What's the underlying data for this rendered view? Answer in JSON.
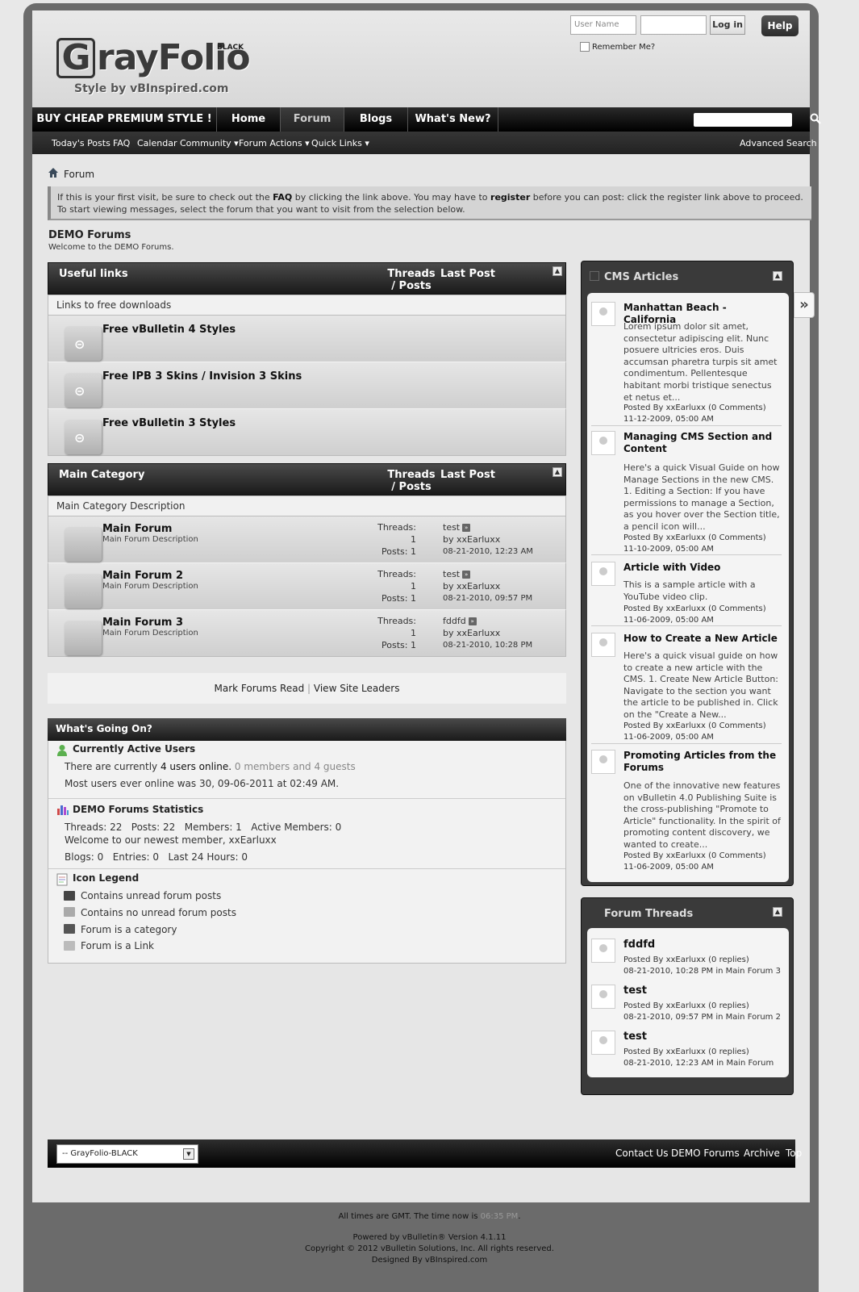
{
  "header": {
    "logo_text": "rayFolio",
    "logo_initial": "G",
    "logo_badge": "BLACK",
    "logo_sub": "Style by vBInspired.com",
    "login": {
      "user_placeholder": "User Name",
      "pass_placeholder": "",
      "login_btn": "Log in",
      "remember": "Remember Me?"
    },
    "help": "Help"
  },
  "navbar": {
    "tabs": [
      "BUY CHEAP PREMIUM STYLE !",
      "Home",
      "Forum",
      "Blogs",
      "What's New?"
    ],
    "selected_tab": "Forum",
    "sub_items": [
      "Today's Posts",
      "FAQ",
      "Calendar",
      "Community",
      "Forum Actions",
      "Quick Links"
    ],
    "advanced_search": "Advanced Search"
  },
  "breadcrumb": "Forum",
  "notice": {
    "pre": "If this is your first visit, be sure to check out the ",
    "faq": "FAQ",
    "mid": " by clicking the link above. You may have to ",
    "register": "register",
    "post": " before you can post: click the register link above to proceed. To start viewing messages, select the forum that you want to visit from the selection below."
  },
  "page": {
    "title": "DEMO Forums",
    "desc": "Welcome to the DEMO Forums."
  },
  "useful": {
    "title": "Useful links",
    "col_threads": "Threads / Posts",
    "col_last": "Last Post",
    "desc": "Links to free downloads",
    "forums": [
      "Free vBulletin 4 Styles",
      "Free IPB 3 Skins / Invision 3 Skins",
      "Free vBulletin 3 Styles"
    ]
  },
  "main_cat": {
    "title": "Main Category",
    "col_threads": "Threads / Posts",
    "col_last": "Last Post",
    "desc": "Main Category Description",
    "forums": [
      {
        "title": "Main Forum",
        "desc": "Main Forum Description",
        "threads_lbl": "Threads:",
        "threads": "1",
        "posts_lbl": "Posts:",
        "posts": "1",
        "last_title": "test",
        "by": "by",
        "last_user": "xxEarluxx",
        "last_date": "08-21-2010, 12:23 AM"
      },
      {
        "title": "Main Forum 2",
        "desc": "Main Forum Description",
        "threads_lbl": "Threads:",
        "threads": "1",
        "posts_lbl": "Posts:",
        "posts": "1",
        "last_title": "test",
        "by": "by",
        "last_user": "xxEarluxx",
        "last_date": "08-21-2010, 09:57 PM"
      },
      {
        "title": "Main Forum 3",
        "desc": "Main Forum Description",
        "threads_lbl": "Threads:",
        "threads": "1",
        "posts_lbl": "Posts:",
        "posts": "1",
        "last_title": "fddfd",
        "by": "by",
        "last_user": "xxEarluxx",
        "last_date": "08-21-2010, 10:28 PM"
      }
    ]
  },
  "markbar": {
    "mark": "Mark Forums Read",
    "sep": "|",
    "leaders": "View Site Leaders"
  },
  "wgo": {
    "title": "What's Going On?",
    "active_title": "Currently Active Users",
    "active_pre": "There are currently ",
    "active_link": "4 users online.",
    "active_post": " 0 members and 4 guests",
    "most": "Most users ever online was 30, 09-06-2011 at 02:49 AM.",
    "stats_title": "DEMO Forums Statistics",
    "stats_line1": "Threads: 22   Posts: 22   Members: 1   Active Members: 0",
    "stats_newest_pre": "Welcome to our newest member, ",
    "stats_newest": "xxEarluxx",
    "stats_blogs": "Blogs: 0   Entries: 0   Last 24 Hours: 0",
    "legend_title": "Icon Legend",
    "legend": [
      "Contains unread forum posts",
      "Contains no unread forum posts",
      "Forum is a category",
      "Forum is a Link"
    ]
  },
  "cms": {
    "title": "CMS Articles",
    "articles": [
      {
        "title": "Manhattan Beach - California",
        "body": "Lorem ipsum dolor sit amet, consectetur adipiscing elit. Nunc posuere ultricies eros. Duis accumsan pharetra turpis sit amet condimentum. Pellentesque habitant morbi tristique senectus et netus et...",
        "posted_by": "Posted By",
        "user": "xxEarluxx",
        "comments": "(0 Comments)",
        "date": "11-12-2009, 05:00 AM"
      },
      {
        "title": "Managing CMS Section and Content",
        "body": "Here's a quick Visual Guide on how Manage Sections in the new CMS. 1. Editing a Section: If you have permissions to manage a Section, as you hover over the Section title, a pencil icon will...",
        "posted_by": "Posted By",
        "user": "xxEarluxx",
        "comments": "(0 Comments)",
        "date": "11-10-2009, 05:00 AM"
      },
      {
        "title": "Article with Video",
        "body": "This is a sample article with a YouTube video clip.",
        "posted_by": "Posted By",
        "user": "xxEarluxx",
        "comments": "(0 Comments)",
        "date": "11-06-2009, 05:00 AM"
      },
      {
        "title": "How to Create a New Article",
        "body": "Here's a quick visual guide on how to create a new article with the CMS. 1. Create New Article Button: Navigate to the section you want the article to be published in. Click on the \"Create a New...",
        "posted_by": "Posted By",
        "user": "xxEarluxx",
        "comments": "(0 Comments)",
        "date": "11-06-2009, 05:00 AM"
      },
      {
        "title": "Promoting Articles from the Forums",
        "body": "One of the innovative new features on vBulletin 4.0 Publishing Suite is the cross-publishing \"Promote to Article\" functionality. In the spirit of promoting content discovery, we wanted to create...",
        "posted_by": "Posted By",
        "user": "xxEarluxx",
        "comments": "(0 Comments)",
        "date": "11-06-2009, 05:00 AM"
      }
    ]
  },
  "threads": {
    "title": "Forum Threads",
    "items": [
      {
        "title": "fddfd",
        "posted_by": "Posted By",
        "user": "xxEarluxx",
        "replies": "(0 replies)",
        "date": "08-21-2010, 10:28 PM",
        "in": "in",
        "forum": "Main Forum 3"
      },
      {
        "title": "test",
        "posted_by": "Posted By",
        "user": "xxEarluxx",
        "replies": "(0 replies)",
        "date": "08-21-2010, 09:57 PM",
        "in": "in",
        "forum": "Main Forum 2"
      },
      {
        "title": "test",
        "posted_by": "Posted By",
        "user": "xxEarluxx",
        "replies": "(0 replies)",
        "date": "08-21-2010, 12:23 AM",
        "in": "in",
        "forum": "Main Forum"
      }
    ]
  },
  "footer": {
    "style_select": "-- GrayFolio-BLACK",
    "links": [
      "Contact Us",
      "DEMO Forums",
      "Archive",
      "Top"
    ],
    "time_pre": "All times are GMT. The time now is ",
    "time": "06:35 PM",
    "time_post": ".",
    "powered": "Powered by vBulletin® Version 4.1.11",
    "copyright": "Copyright © 2012 vBulletin Solutions, Inc. All rights reserved.",
    "designed": "Designed By vBInspired.com"
  },
  "colors": {
    "bg": "#6b6b6b",
    "bar": "#1a1a1a",
    "panel": "#e6e6e6"
  }
}
